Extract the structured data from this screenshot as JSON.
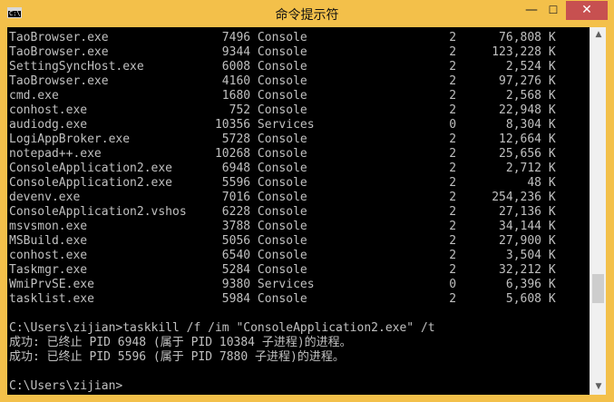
{
  "window": {
    "title": "命令提示符",
    "icon_text": "C:\\",
    "buttons": {
      "minimize": "—",
      "maximize": "☐",
      "close": "✕"
    },
    "accent_color": "#f3c04a",
    "close_color": "#c75050"
  },
  "console": {
    "lines": [
      "TaoBrowser.exe                7496 Console                    2      76,808 K",
      "TaoBrowser.exe                9344 Console                    2     123,228 K",
      "SettingSyncHost.exe           6008 Console                    2       2,524 K",
      "TaoBrowser.exe                4160 Console                    2      97,276 K",
      "cmd.exe                       1680 Console                    2       2,568 K",
      "conhost.exe                    752 Console                    2      22,948 K",
      "audiodg.exe                  10356 Services                   0       8,304 K",
      "LogiAppBroker.exe             5728 Console                    2      12,664 K",
      "notepad++.exe                10268 Console                    2      25,656 K",
      "ConsoleApplication2.exe       6948 Console                    2       2,712 K",
      "ConsoleApplication2.exe       5596 Console                    2          48 K",
      "devenv.exe                    7016 Console                    2     254,236 K",
      "ConsoleApplication2.vshos     6228 Console                    2      27,136 K",
      "msvsmon.exe                   3788 Console                    2      34,144 K",
      "MSBuild.exe                   5056 Console                    2      27,900 K",
      "conhost.exe                   6540 Console                    2       3,504 K",
      "Taskmgr.exe                   5284 Console                    2      32,212 K",
      "WmiPrvSE.exe                  9380 Services                   0       6,396 K",
      "tasklist.exe                  5984 Console                    2       5,608 K",
      "",
      "C:\\Users\\zijian>taskkill /f /im \"ConsoleApplication2.exe\" /t",
      "成功: 已终止 PID 6948 (属于 PID 10384 子进程)的进程。",
      "成功: 已终止 PID 5596 (属于 PID 7880 子进程)的进程。",
      "",
      "C:\\Users\\zijian>"
    ]
  },
  "scrollbar": {
    "up_icon": "▲",
    "down_icon": "▼",
    "position_fraction": 0.95
  }
}
